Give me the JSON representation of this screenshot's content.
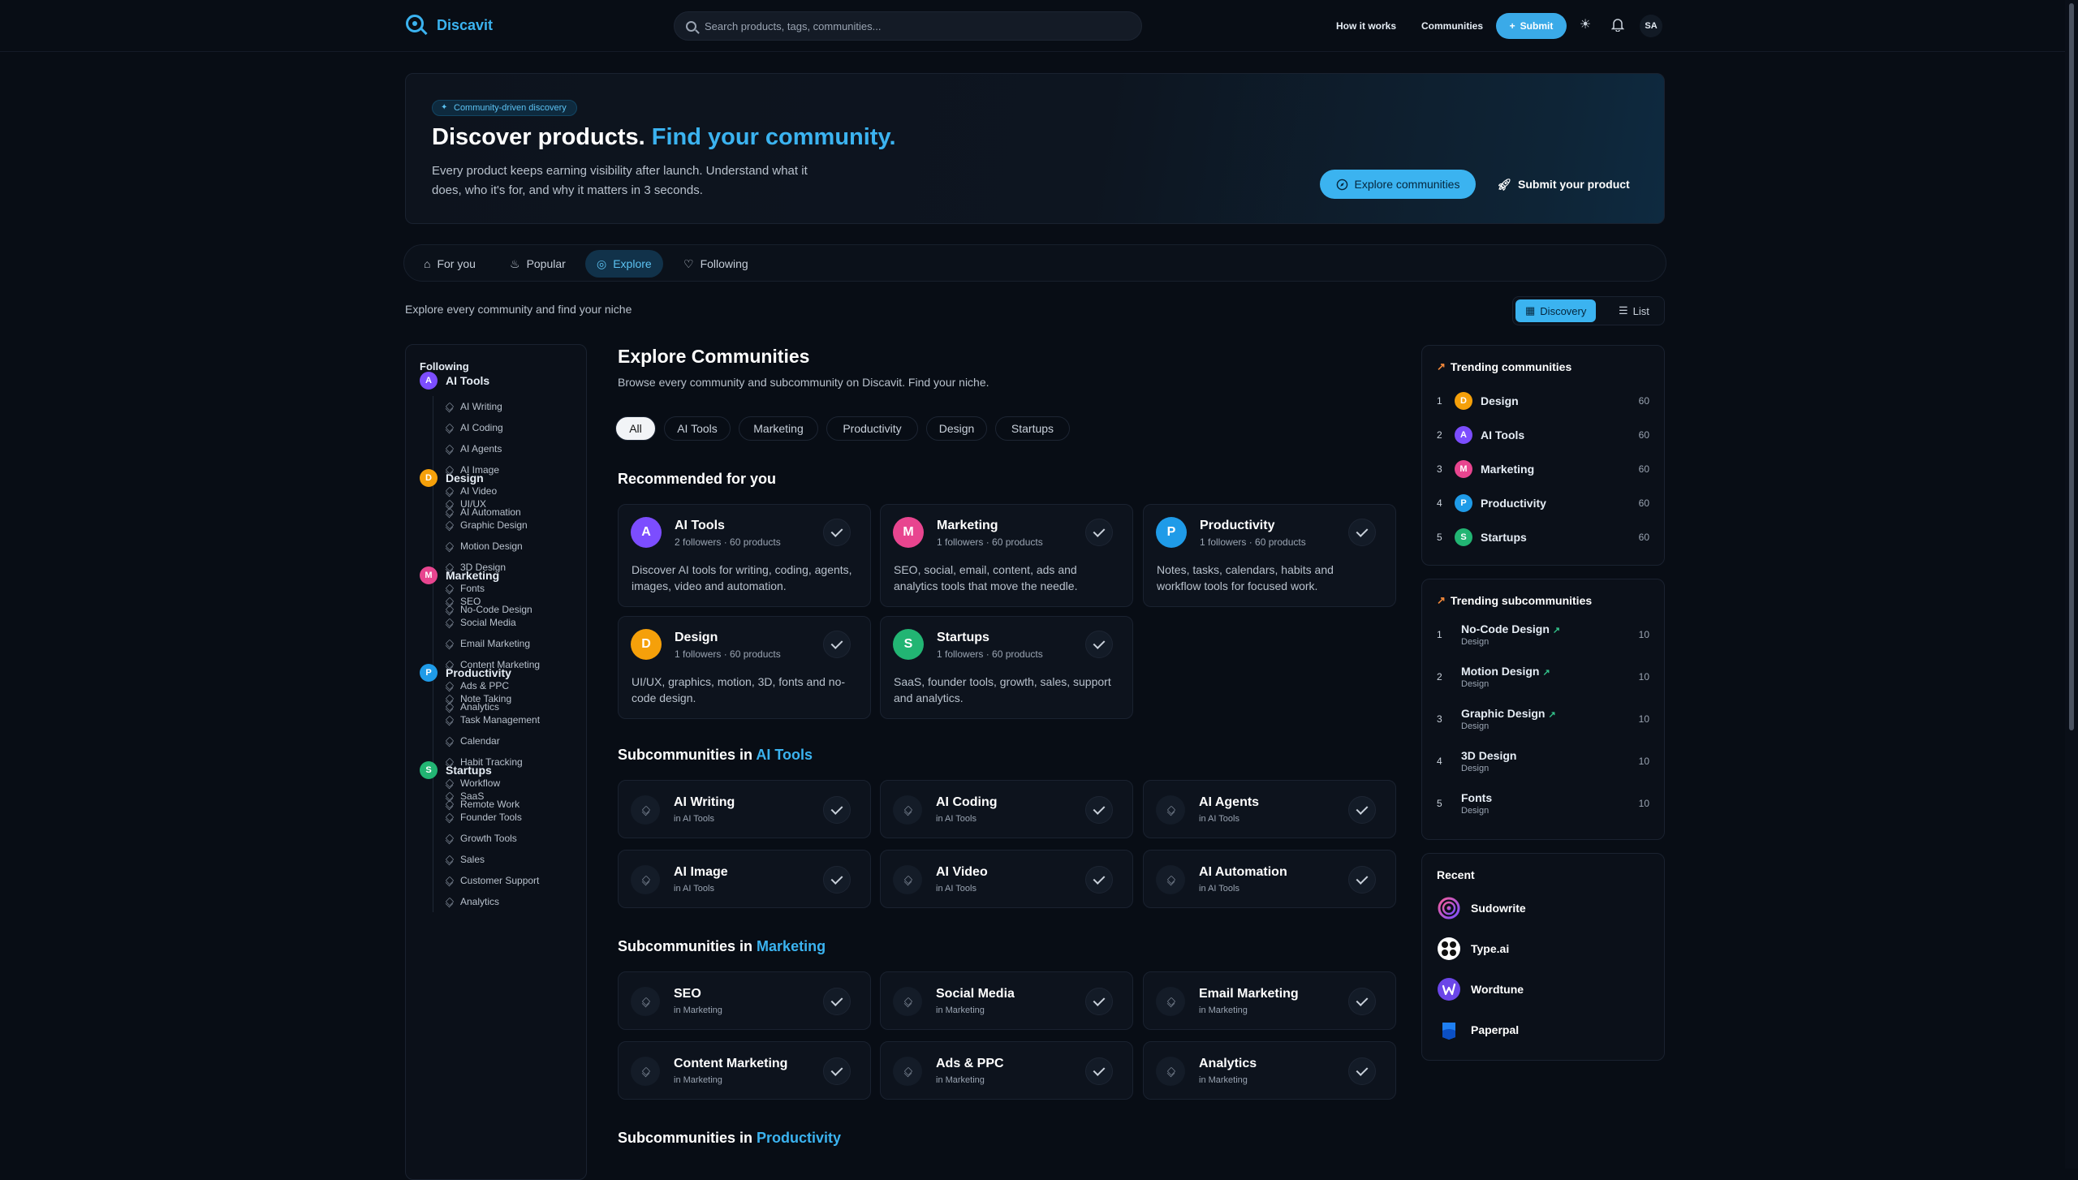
{
  "header": {
    "brand": "Discavit",
    "search_placeholder": "Search products, tags, communities...",
    "nav": [
      "How it works",
      "Communities"
    ],
    "submit_label": "Submit",
    "user_initials": "SA"
  },
  "hero": {
    "badge": "Community-driven discovery",
    "title_main": "Discover products.",
    "title_accent": "Find your community.",
    "description": "Every product keeps earning visibility after launch. Understand what it does, who it's for, and why it matters in 3 seconds.",
    "primary_button": "Explore communities",
    "secondary_button": "Submit your product"
  },
  "tabs": [
    "For you",
    "Popular",
    "Explore",
    "Following"
  ],
  "subtitle": "Explore every community and find your niche",
  "view_toggle": [
    "Discovery",
    "List"
  ],
  "sidebar": {
    "heading": "Following",
    "groups": [
      {
        "letter": "A",
        "name": "AI Tools",
        "color": "#7c4dff",
        "subs": [
          "AI Writing",
          "AI Coding",
          "AI Agents",
          "AI Image",
          "AI Video",
          "AI Automation"
        ]
      },
      {
        "letter": "D",
        "name": "Design",
        "color": "#f5a00a",
        "subs": [
          "UI/UX",
          "Graphic Design",
          "Motion Design",
          "3D Design",
          "Fonts",
          "No-Code Design"
        ]
      },
      {
        "letter": "M",
        "name": "Marketing",
        "color": "#e8458f",
        "subs": [
          "SEO",
          "Social Media",
          "Email Marketing",
          "Content Marketing",
          "Ads & PPC",
          "Analytics"
        ]
      },
      {
        "letter": "P",
        "name": "Productivity",
        "color": "#1f9be8",
        "subs": [
          "Note Taking",
          "Task Management",
          "Calendar",
          "Habit Tracking",
          "Workflow",
          "Remote Work"
        ]
      },
      {
        "letter": "S",
        "name": "Startups",
        "color": "#22b573",
        "subs": [
          "SaaS",
          "Founder Tools",
          "Growth Tools",
          "Sales",
          "Customer Support",
          "Analytics"
        ]
      }
    ]
  },
  "main": {
    "title": "Explore Communities",
    "subtitle": "Browse every community and subcommunity on Discavit. Find your niche.",
    "filters": [
      "All",
      "AI Tools",
      "Marketing",
      "Productivity",
      "Design",
      "Startups"
    ],
    "recommended_title": "Recommended for you",
    "recommended": [
      {
        "letter": "A",
        "name": "AI Tools",
        "color": "#7c4dff",
        "meta": "2 followers · 60 products",
        "desc": "Discover AI tools for writing, coding, agents, images, video and automation."
      },
      {
        "letter": "M",
        "name": "Marketing",
        "color": "#e8458f",
        "meta": "1 followers · 60 products",
        "desc": "SEO, social, email, content, ads and analytics tools that move the needle."
      },
      {
        "letter": "P",
        "name": "Productivity",
        "color": "#1f9be8",
        "meta": "1 followers · 60 products",
        "desc": "Notes, tasks, calendars, habits and workflow tools for focused work."
      },
      {
        "letter": "D",
        "name": "Design",
        "color": "#f5a00a",
        "meta": "1 followers · 60 products",
        "desc": "UI/UX, graphics, motion, 3D, fonts and no-code design."
      },
      {
        "letter": "S",
        "name": "Startups",
        "color": "#22b573",
        "meta": "1 followers · 60 products",
        "desc": "SaaS, founder tools, growth, sales, support and analytics."
      }
    ],
    "sections": [
      {
        "prefix": "Subcommunities in",
        "accent": "AI Tools",
        "items": [
          {
            "name": "AI Writing",
            "meta": "in AI Tools"
          },
          {
            "name": "AI Coding",
            "meta": "in AI Tools"
          },
          {
            "name": "AI Agents",
            "meta": "in AI Tools"
          },
          {
            "name": "AI Image",
            "meta": "in AI Tools"
          },
          {
            "name": "AI Video",
            "meta": "in AI Tools"
          },
          {
            "name": "AI Automation",
            "meta": "in AI Tools"
          }
        ]
      },
      {
        "prefix": "Subcommunities in",
        "accent": "Marketing",
        "items": [
          {
            "name": "SEO",
            "meta": "in Marketing"
          },
          {
            "name": "Social Media",
            "meta": "in Marketing"
          },
          {
            "name": "Email Marketing",
            "meta": "in Marketing"
          },
          {
            "name": "Content Marketing",
            "meta": "in Marketing"
          },
          {
            "name": "Ads & PPC",
            "meta": "in Marketing"
          },
          {
            "name": "Analytics",
            "meta": "in Marketing"
          }
        ]
      },
      {
        "prefix": "Subcommunities in",
        "accent": "Productivity",
        "items": []
      }
    ]
  },
  "trending_communities": {
    "title": "Trending communities",
    "items": [
      {
        "rank": "1",
        "letter": "D",
        "name": "Design",
        "color": "#f5a00a",
        "count": "60"
      },
      {
        "rank": "2",
        "letter": "A",
        "name": "AI Tools",
        "color": "#7c4dff",
        "count": "60"
      },
      {
        "rank": "3",
        "letter": "M",
        "name": "Marketing",
        "color": "#e8458f",
        "count": "60"
      },
      {
        "rank": "4",
        "letter": "P",
        "name": "Productivity",
        "color": "#1f9be8",
        "count": "60"
      },
      {
        "rank": "5",
        "letter": "S",
        "name": "Startups",
        "color": "#22b573",
        "count": "60"
      }
    ]
  },
  "trending_subcommunities": {
    "title": "Trending subcommunities",
    "items": [
      {
        "rank": "1",
        "name": "No-Code Design",
        "cat": "Design",
        "count": "10",
        "trending": true
      },
      {
        "rank": "2",
        "name": "Motion Design",
        "cat": "Design",
        "count": "10",
        "trending": true
      },
      {
        "rank": "3",
        "name": "Graphic Design",
        "cat": "Design",
        "count": "10",
        "trending": true
      },
      {
        "rank": "4",
        "name": "3D Design",
        "cat": "Design",
        "count": "10",
        "trending": false
      },
      {
        "rank": "5",
        "name": "Fonts",
        "cat": "Design",
        "count": "10",
        "trending": false
      }
    ]
  },
  "recent": {
    "title": "Recent",
    "items": [
      {
        "name": "Sudowrite",
        "icon": "sudowrite-logo"
      },
      {
        "name": "Type.ai",
        "icon": "typeai-logo"
      },
      {
        "name": "Wordtune",
        "icon": "wordtune-logo"
      },
      {
        "name": "Paperpal",
        "icon": "paperpal-logo"
      }
    ]
  }
}
